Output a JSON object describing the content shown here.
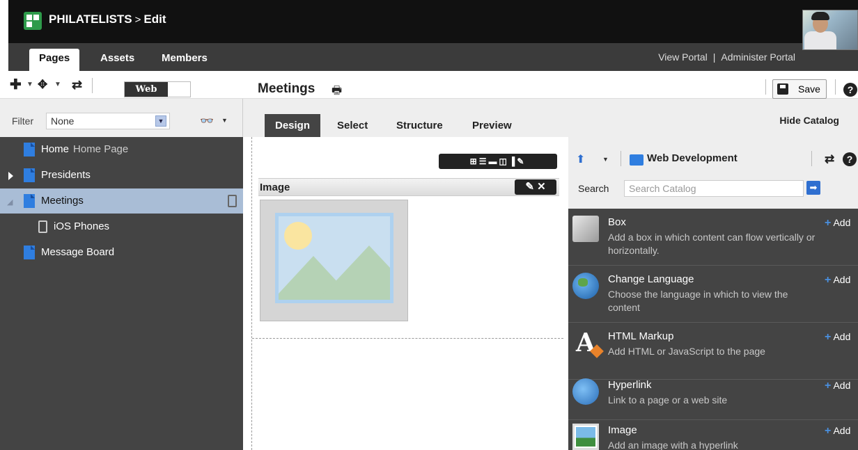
{
  "app": {
    "title": "PHILATELISTS",
    "separator": ">",
    "mode": "Edit"
  },
  "nav": {
    "tabs": [
      {
        "label": "Pages"
      },
      {
        "label": "Assets"
      },
      {
        "label": "Members"
      }
    ],
    "view_portal": "View Portal",
    "divider": "|",
    "administer_portal": "Administer Portal"
  },
  "toolbar": {
    "add_icon": "plus-icon",
    "move_icon": "move-icon",
    "refresh_icon": "refresh-icon",
    "device_toggle": "Web",
    "page_name": "Meetings",
    "save_label": "Save",
    "help": "?"
  },
  "filter": {
    "label": "Filter",
    "value": "None"
  },
  "tree": {
    "items": [
      {
        "label": "Home",
        "sub": "Home Page"
      },
      {
        "label": "Presidents"
      },
      {
        "label": "Meetings"
      },
      {
        "label": "iOS Phones"
      },
      {
        "label": "Message Board"
      }
    ]
  },
  "design_tabs": [
    {
      "label": "Design"
    },
    {
      "label": "Select"
    },
    {
      "label": "Structure"
    },
    {
      "label": "Preview"
    }
  ],
  "hide_catalog": "Hide Catalog",
  "canvas": {
    "image_label": "Image"
  },
  "catalog": {
    "folder": "Web Development",
    "search_label": "Search",
    "search_placeholder": "Search Catalog",
    "add_label": "Add",
    "items": [
      {
        "name": "Box",
        "desc1": "Add a box in which content can flow vertically or",
        "desc2": "horizontally.",
        "icon": "box-icon"
      },
      {
        "name": "Change Language",
        "desc1": "Choose the language in which to view the",
        "desc2": "content",
        "icon": "globe-icon"
      },
      {
        "name": "HTML Markup",
        "desc1": "Add HTML or JavaScript to the page",
        "desc2": "",
        "icon": "html-icon"
      },
      {
        "name": "Hyperlink",
        "desc1": "Link to a page or a web site",
        "desc2": "",
        "icon": "link-icon"
      },
      {
        "name": "Image",
        "desc1": "Add an image with a hyperlink",
        "desc2": "",
        "icon": "image-icon"
      }
    ]
  },
  "colors": {
    "accent_blue": "#2f7ee0",
    "selected_row": "#a9bdd6",
    "dark_panel": "#444444"
  }
}
